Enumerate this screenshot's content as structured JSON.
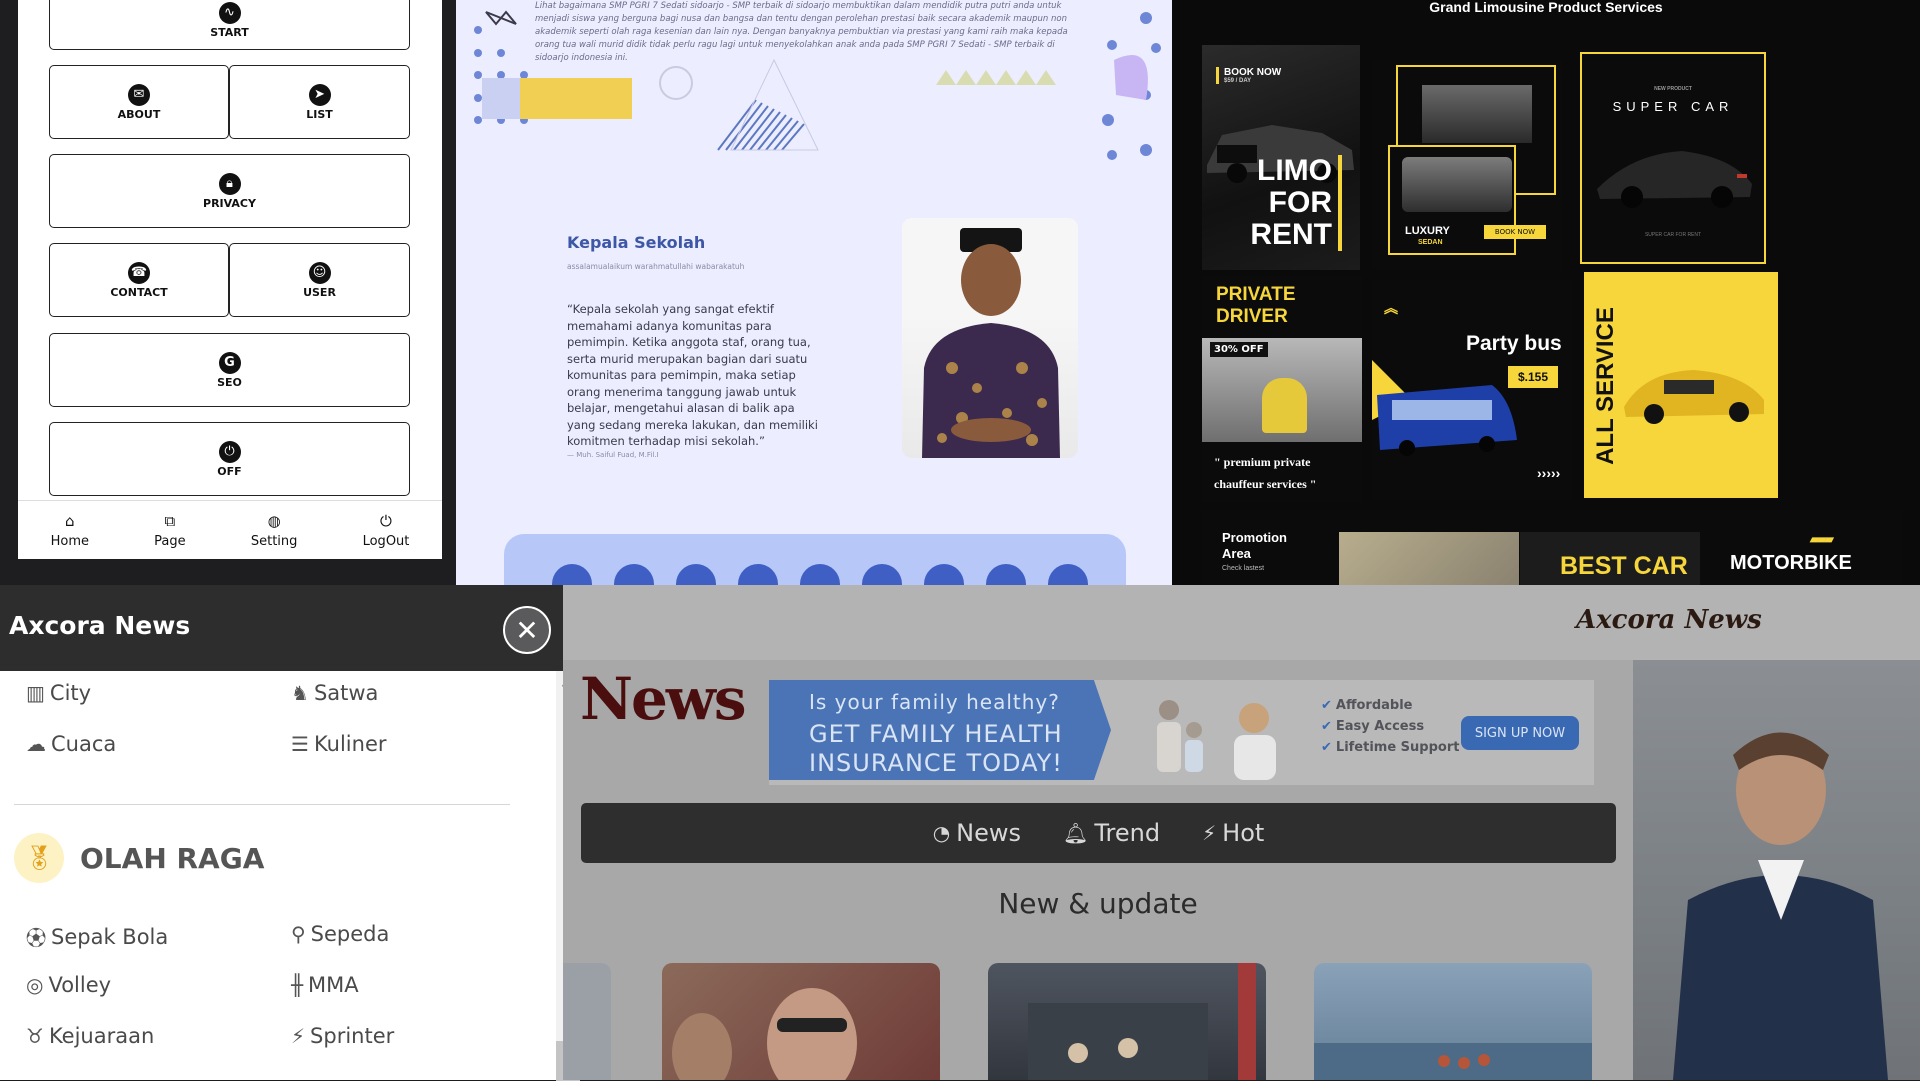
{
  "mobile_app": {
    "buttons": [
      {
        "label": "START",
        "icon": "pulse-icon"
      },
      {
        "label": "ABOUT",
        "icon": "chat-icon"
      },
      {
        "label": "LIST",
        "icon": "send-icon"
      },
      {
        "label": "PRIVACY",
        "icon": "lock-icon"
      },
      {
        "label": "CONTACT",
        "icon": "headset-icon"
      },
      {
        "label": "USER",
        "icon": "user-icon"
      },
      {
        "label": "SEO",
        "icon": "google-icon"
      },
      {
        "label": "OFF",
        "icon": "power-icon"
      }
    ],
    "bottom_nav": [
      {
        "label": "Home",
        "icon": "home-icon"
      },
      {
        "label": "Page",
        "icon": "code-icon"
      },
      {
        "label": "Setting",
        "icon": "palette-icon"
      },
      {
        "label": "LogOut",
        "icon": "power-icon"
      }
    ]
  },
  "school_page": {
    "intro": "Lihat bagaimana SMP PGRI 7 Sedati sidoarjo - SMP terbaik di sidoarjo membuktikan dalam mendidik putra putri anda untuk menjadi siswa yang berguna bagi nusa dan bangsa dan tentu dengan perolehan prestasi baik secara akademik maupun non akademik seperti olah raga kesenian dan lain nya. Dengan banyaknya pembuktian via prestasi yang kami raih maka kepada orang tua wali murid didik tidak perlu ragu lagi untuk menyekolahkan anak anda pada SMP PGRI 7 Sedati - SMP terbaik di sidoarjo indonesia ini.",
    "heading": "Kepala Sekolah",
    "greeting": "assalamualaikum warahmatullahi wabarakatuh",
    "quote": "“Kepala sekolah yang sangat efektif memahami adanya komunitas para pemimpin. Ketika anggota staf, orang tua, serta murid merupakan bagian dari suatu komunitas para pemimpin, maka setiap orang menerima tanggung jawab untuk belajar, mengetahui alasan di balik apa yang sedang mereka lakukan, dan memiliki komitmen terhadap misi sekolah.”",
    "signature": "— Muh. Saiful Fuad, M.Fil.I"
  },
  "limo_collage": {
    "title": "Grand Limousine Product Services",
    "book_now": "BOOK NOW",
    "book_price": "$59 / DAY",
    "limo_for_rent": [
      "LIMO",
      "FOR",
      "RENT"
    ],
    "luxury": "LUXURY",
    "sedan": "SEDAN",
    "book_now_small": "BOOK NOW",
    "new_product": "NEW PRODUCT",
    "super_car": "SUPER CAR",
    "super_car_sub": "SUPER CAR FOR RENT",
    "private_driver": [
      "PRIVATE",
      "DRIVER"
    ],
    "discount": "30% OFF",
    "chauffeur_quote": "\" premium private chauffeur services \"",
    "party_bus": "Party bus",
    "party_price": "$.155",
    "all_service": "ALL SERVICE",
    "promotion": [
      "Promotion",
      "Area"
    ],
    "check_lastest": "Check lastest",
    "best_car": "BEST CAR",
    "motorbike": "MOTORBIKE"
  },
  "news_drawer": {
    "title": "Axcora News",
    "items_top": [
      {
        "label": "City",
        "icon": "city-icon"
      },
      {
        "label": "Satwa",
        "icon": "animal-icon"
      },
      {
        "label": "Cuaca",
        "icon": "weather-icon"
      },
      {
        "label": "Kuliner",
        "icon": "food-icon"
      }
    ],
    "section_title": "OLAH RAGA",
    "items_sport": [
      {
        "label": "Sepak Bola",
        "icon": "soccer-ball-icon"
      },
      {
        "label": "Sepeda",
        "icon": "bicycle-icon"
      },
      {
        "label": "Volley",
        "icon": "volleyball-icon"
      },
      {
        "label": "MMA",
        "icon": "dumbbell-icon"
      },
      {
        "label": "Kejuaraan",
        "icon": "trophy-icon"
      },
      {
        "label": "Sprinter",
        "icon": "runner-icon"
      }
    ]
  },
  "news_site": {
    "brand": "Axcora News",
    "logo": "News",
    "ad": {
      "question": "Is your family healthy?",
      "headline_1": "GET FAMILY HEALTH",
      "headline_2": "INSURANCE TODAY!",
      "checks": [
        "Affordable",
        "Easy Access",
        "Lifetime Support"
      ],
      "cta": "SIGN UP NOW"
    },
    "nav": [
      {
        "label": "News",
        "icon": "rss-icon"
      },
      {
        "label": "Trend",
        "icon": "bell-icon"
      },
      {
        "label": "Hot",
        "icon": "bolt-icon"
      }
    ],
    "section_title": "New & update"
  }
}
